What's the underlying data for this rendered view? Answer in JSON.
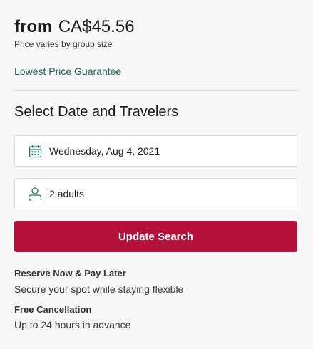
{
  "price": {
    "from_label": "from",
    "amount": "CA$45.56",
    "note": "Price varies by group size"
  },
  "guarantee": {
    "label": "Lowest Price Guarantee"
  },
  "booking": {
    "title": "Select Date and Travelers",
    "date_value": "Wednesday, Aug 4, 2021",
    "travelers_value": "2 adults",
    "button_label": "Update Search"
  },
  "info": {
    "reserve_title": "Reserve Now & Pay Later",
    "reserve_text": "Secure your spot while staying flexible",
    "cancel_title": "Free Cancellation",
    "cancel_text": "Up to 24 hours in advance"
  },
  "colors": {
    "accent": "#b5123b",
    "link": "#1b5e57",
    "icon": "#1b6f68"
  },
  "icons": {
    "date": "calendar-icon",
    "travelers": "person-icon"
  }
}
